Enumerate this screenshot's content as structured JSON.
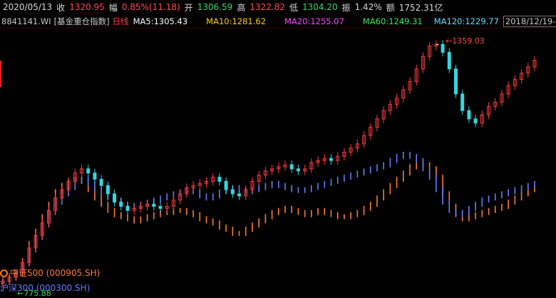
{
  "quote": {
    "date": "2020/05/13",
    "close_label": "收",
    "close_value": "1320.95",
    "change_label": "幅",
    "change_value": "0.85%(11.18)",
    "open_label": "开",
    "open_value": "1306.59",
    "high_label": "高",
    "high_value": "1322.82",
    "low_label": "低",
    "low_value": "1304.20",
    "amplitude_label": "振",
    "amplitude_value": "1.42%",
    "turnover_label": "额",
    "turnover_value": "1752.31亿"
  },
  "indicator_bar": {
    "code": "8841141.WI",
    "name": "[基金重仓指数]",
    "period": "日线",
    "ma5": "MA5:1305.43",
    "ma10": "MA10:1281.62",
    "ma20": "MA20:1255.07",
    "ma60": "MA60:1249.31",
    "ma120": "MA120:1229.77",
    "date_range": "2018/12/19-...",
    "dropdown_symbol": "▾"
  },
  "colors": {
    "up": "#ff3b3b",
    "down": "#35d6e0",
    "ma5": "#ffffff",
    "ma10": "#ffcc00",
    "ma20": "#ff44ff",
    "ma60": "#33ee55",
    "ma120": "#66ddff",
    "compare1": "#ff7a3a",
    "compare2": "#6b7bff"
  },
  "chart_data": {
    "type": "candlestick",
    "period": "daily",
    "x_range": [
      "2018/12/19",
      "2020/05/13"
    ],
    "main_series": {
      "name": "[基金重仓指数]",
      "close": [
        790,
        800,
        810,
        835,
        870,
        900,
        930,
        960,
        990,
        1010,
        1030,
        1050,
        1060,
        1050,
        1035,
        1020,
        1000,
        980,
        970,
        960,
        965,
        970,
        975,
        970,
        965,
        970,
        985,
        1000,
        1015,
        1020,
        1025,
        1030,
        1040,
        1030,
        1010,
        1000,
        995,
        1010,
        1030,
        1045,
        1055,
        1060,
        1065,
        1070,
        1060,
        1055,
        1060,
        1075,
        1080,
        1085,
        1080,
        1090,
        1100,
        1110,
        1120,
        1140,
        1160,
        1180,
        1200,
        1215,
        1230,
        1250,
        1270,
        1300,
        1330,
        1355,
        1359,
        1340,
        1300,
        1240,
        1200,
        1180,
        1170,
        1190,
        1210,
        1220,
        1240,
        1260,
        1275,
        1290,
        1305,
        1320.95
      ],
      "high": 1359.03,
      "low": 775.88
    },
    "moving_averages": [
      {
        "name": "MA5",
        "value": 1305.43
      },
      {
        "name": "MA10",
        "value": 1281.62
      },
      {
        "name": "MA20",
        "value": 1255.07
      },
      {
        "name": "MA60",
        "value": 1249.31
      },
      {
        "name": "MA120",
        "value": 1229.77
      }
    ],
    "compare_series": [
      {
        "name": "中证500 (000905.SH)",
        "close": [
          790,
          800,
          810,
          840,
          880,
          910,
          945,
          975,
          1005,
          1020,
          1030,
          1035,
          1030,
          1010,
          990,
          975,
          960,
          950,
          945,
          940,
          935,
          940,
          945,
          950,
          955,
          955,
          960,
          960,
          955,
          950,
          940,
          935,
          930,
          920,
          915,
          905,
          905,
          915,
          925,
          935,
          945,
          955,
          960,
          965,
          960,
          955,
          950,
          955,
          960,
          955,
          950,
          945,
          945,
          950,
          955,
          965,
          975,
          990,
          1005,
          1020,
          1035,
          1050,
          1065,
          1075,
          1070,
          1060,
          1040,
          1000,
          970,
          950,
          940,
          945,
          950,
          955,
          960,
          965,
          970,
          980,
          990,
          1000,
          1010,
          1015
        ]
      },
      {
        "name": "沪深300 (000300.SH)",
        "close": [
          790,
          798,
          808,
          832,
          865,
          895,
          925,
          955,
          980,
          1000,
          1015,
          1030,
          1035,
          1025,
          1010,
          1000,
          990,
          985,
          975,
          970,
          972,
          975,
          980,
          985,
          990,
          995,
          1000,
          1005,
          1010,
          1005,
          995,
          990,
          995,
          1005,
          1010,
          1015,
          1010,
          1005,
          1010,
          1015,
          1020,
          1025,
          1020,
          1015,
          1010,
          1008,
          1010,
          1015,
          1020,
          1025,
          1030,
          1035,
          1040,
          1045,
          1050,
          1055,
          1060,
          1065,
          1070,
          1080,
          1090,
          1095,
          1090,
          1080,
          1060,
          1040,
          1010,
          980,
          960,
          950,
          955,
          965,
          975,
          985,
          990,
          995,
          1000,
          1005,
          1010,
          1015,
          1020,
          1025
        ]
      }
    ],
    "annotations": [
      {
        "text": "1359.03",
        "kind": "high"
      },
      {
        "text": "775.88",
        "kind": "low"
      }
    ],
    "y_range": [
      760,
      1380
    ],
    "grid": false,
    "legend_position": "bottom-left"
  },
  "legend": {
    "item1": "中证500 (000905.SH)",
    "item2": "沪深300 (000300.SH)"
  },
  "annotations": {
    "high": "1359.03",
    "low": "775.88"
  }
}
